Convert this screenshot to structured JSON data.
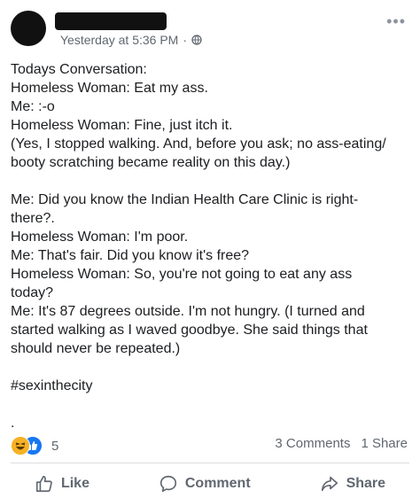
{
  "header": {
    "timestamp": "Yesterday at 5:36 PM",
    "separator": "·",
    "privacy_icon": "globe-icon",
    "more_icon": "more-options-icon"
  },
  "post": {
    "lines": [
      "Todays Conversation:",
      "Homeless Woman: Eat my ass.",
      "Me: :-o",
      "Homeless Woman: Fine, just itch it.",
      "(Yes, I stopped walking. And, before you ask; no ass-eating/",
      "booty scratching became reality on this day.)",
      "",
      "Me: Did you know the Indian Health Care Clinic is right-",
      "there?.",
      "Homeless Woman: I'm poor.",
      "Me: That's fair. Did you know it's free?",
      "Homeless Woman: So, you're not going to eat any ass",
      "today?",
      "Me: It's 87 degrees outside. I'm not hungry. (I turned and",
      "started walking as I waved goodbye. She said things that",
      "should never be repeated.)",
      "",
      "#sexinthecity",
      "",
      "."
    ]
  },
  "reactions": {
    "count": "5",
    "icons": [
      "haha-reaction-icon",
      "like-reaction-icon"
    ]
  },
  "stats": {
    "comments": "3 Comments",
    "shares": "1 Share"
  },
  "actions": {
    "like": "Like",
    "comment": "Comment",
    "share": "Share"
  },
  "colors": {
    "text": "#1c1e21",
    "secondary": "#606770",
    "like_blue": "#1877f2",
    "haha_yellow": "#f7b125"
  }
}
